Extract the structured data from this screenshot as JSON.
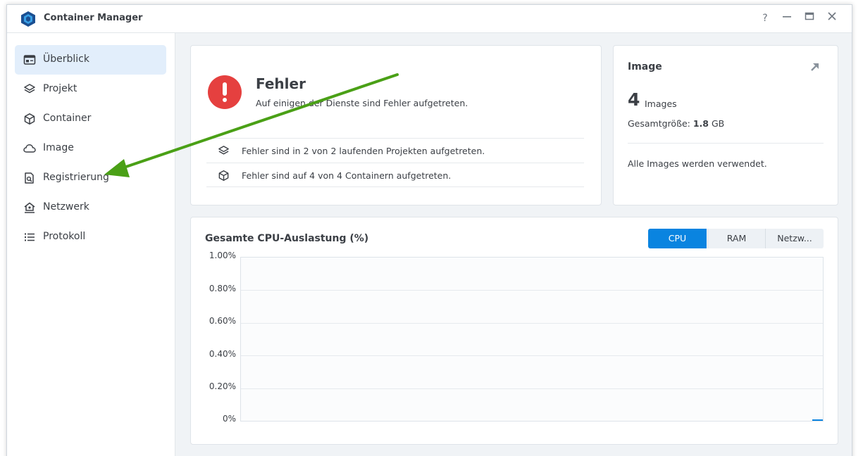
{
  "window": {
    "title": "Container Manager",
    "controls": [
      "?",
      "minimize",
      "maximize",
      "close"
    ]
  },
  "sidebar": {
    "items": [
      {
        "label": "Überblick",
        "icon": "overview-icon",
        "active": true
      },
      {
        "label": "Projekt",
        "icon": "layers-icon",
        "active": false
      },
      {
        "label": "Container",
        "icon": "cube-icon",
        "active": false
      },
      {
        "label": "Image",
        "icon": "cloud-icon",
        "active": false
      },
      {
        "label": "Registrierung",
        "icon": "registry-search-icon",
        "active": false
      },
      {
        "label": "Netzwerk",
        "icon": "network-home-icon",
        "active": false
      },
      {
        "label": "Protokoll",
        "icon": "list-icon",
        "active": false
      }
    ]
  },
  "status_card": {
    "title": "Fehler",
    "subtitle": "Auf einigen der Dienste sind Fehler aufgetreten.",
    "rows": [
      {
        "text": "Fehler sind in 2 von 2 laufenden Projekten aufgetreten.",
        "icon": "layers-icon"
      },
      {
        "text": "Fehler sind auf 4 von 4 Containern aufgetreten.",
        "icon": "cube-icon"
      }
    ]
  },
  "image_card": {
    "title": "Image",
    "count": "4",
    "count_label": "Images",
    "size_label": "Gesamtgröße:",
    "size_value": "1.8",
    "size_unit": "GB",
    "note": "Alle Images werden verwendet."
  },
  "chart": {
    "title": "Gesamte CPU-Auslastung (%)",
    "tabs": [
      {
        "label": "CPU",
        "active": true
      },
      {
        "label": "RAM",
        "active": false
      },
      {
        "label": "Netzw...",
        "active": false
      }
    ]
  },
  "chart_data": {
    "type": "line",
    "title": "Gesamte CPU-Auslastung (%)",
    "y_ticks": [
      "1.00%",
      "0.80%",
      "0.60%",
      "0.40%",
      "0.20%",
      "0%"
    ],
    "ylim": [
      0,
      1
    ],
    "grid": true,
    "series": [
      {
        "values": [
          0
        ]
      }
    ]
  },
  "colors": {
    "accent": "#0a84e0",
    "error": "#e5403f",
    "active_nav": "#e2eefb",
    "annotation_arrow": "#4aa016"
  }
}
